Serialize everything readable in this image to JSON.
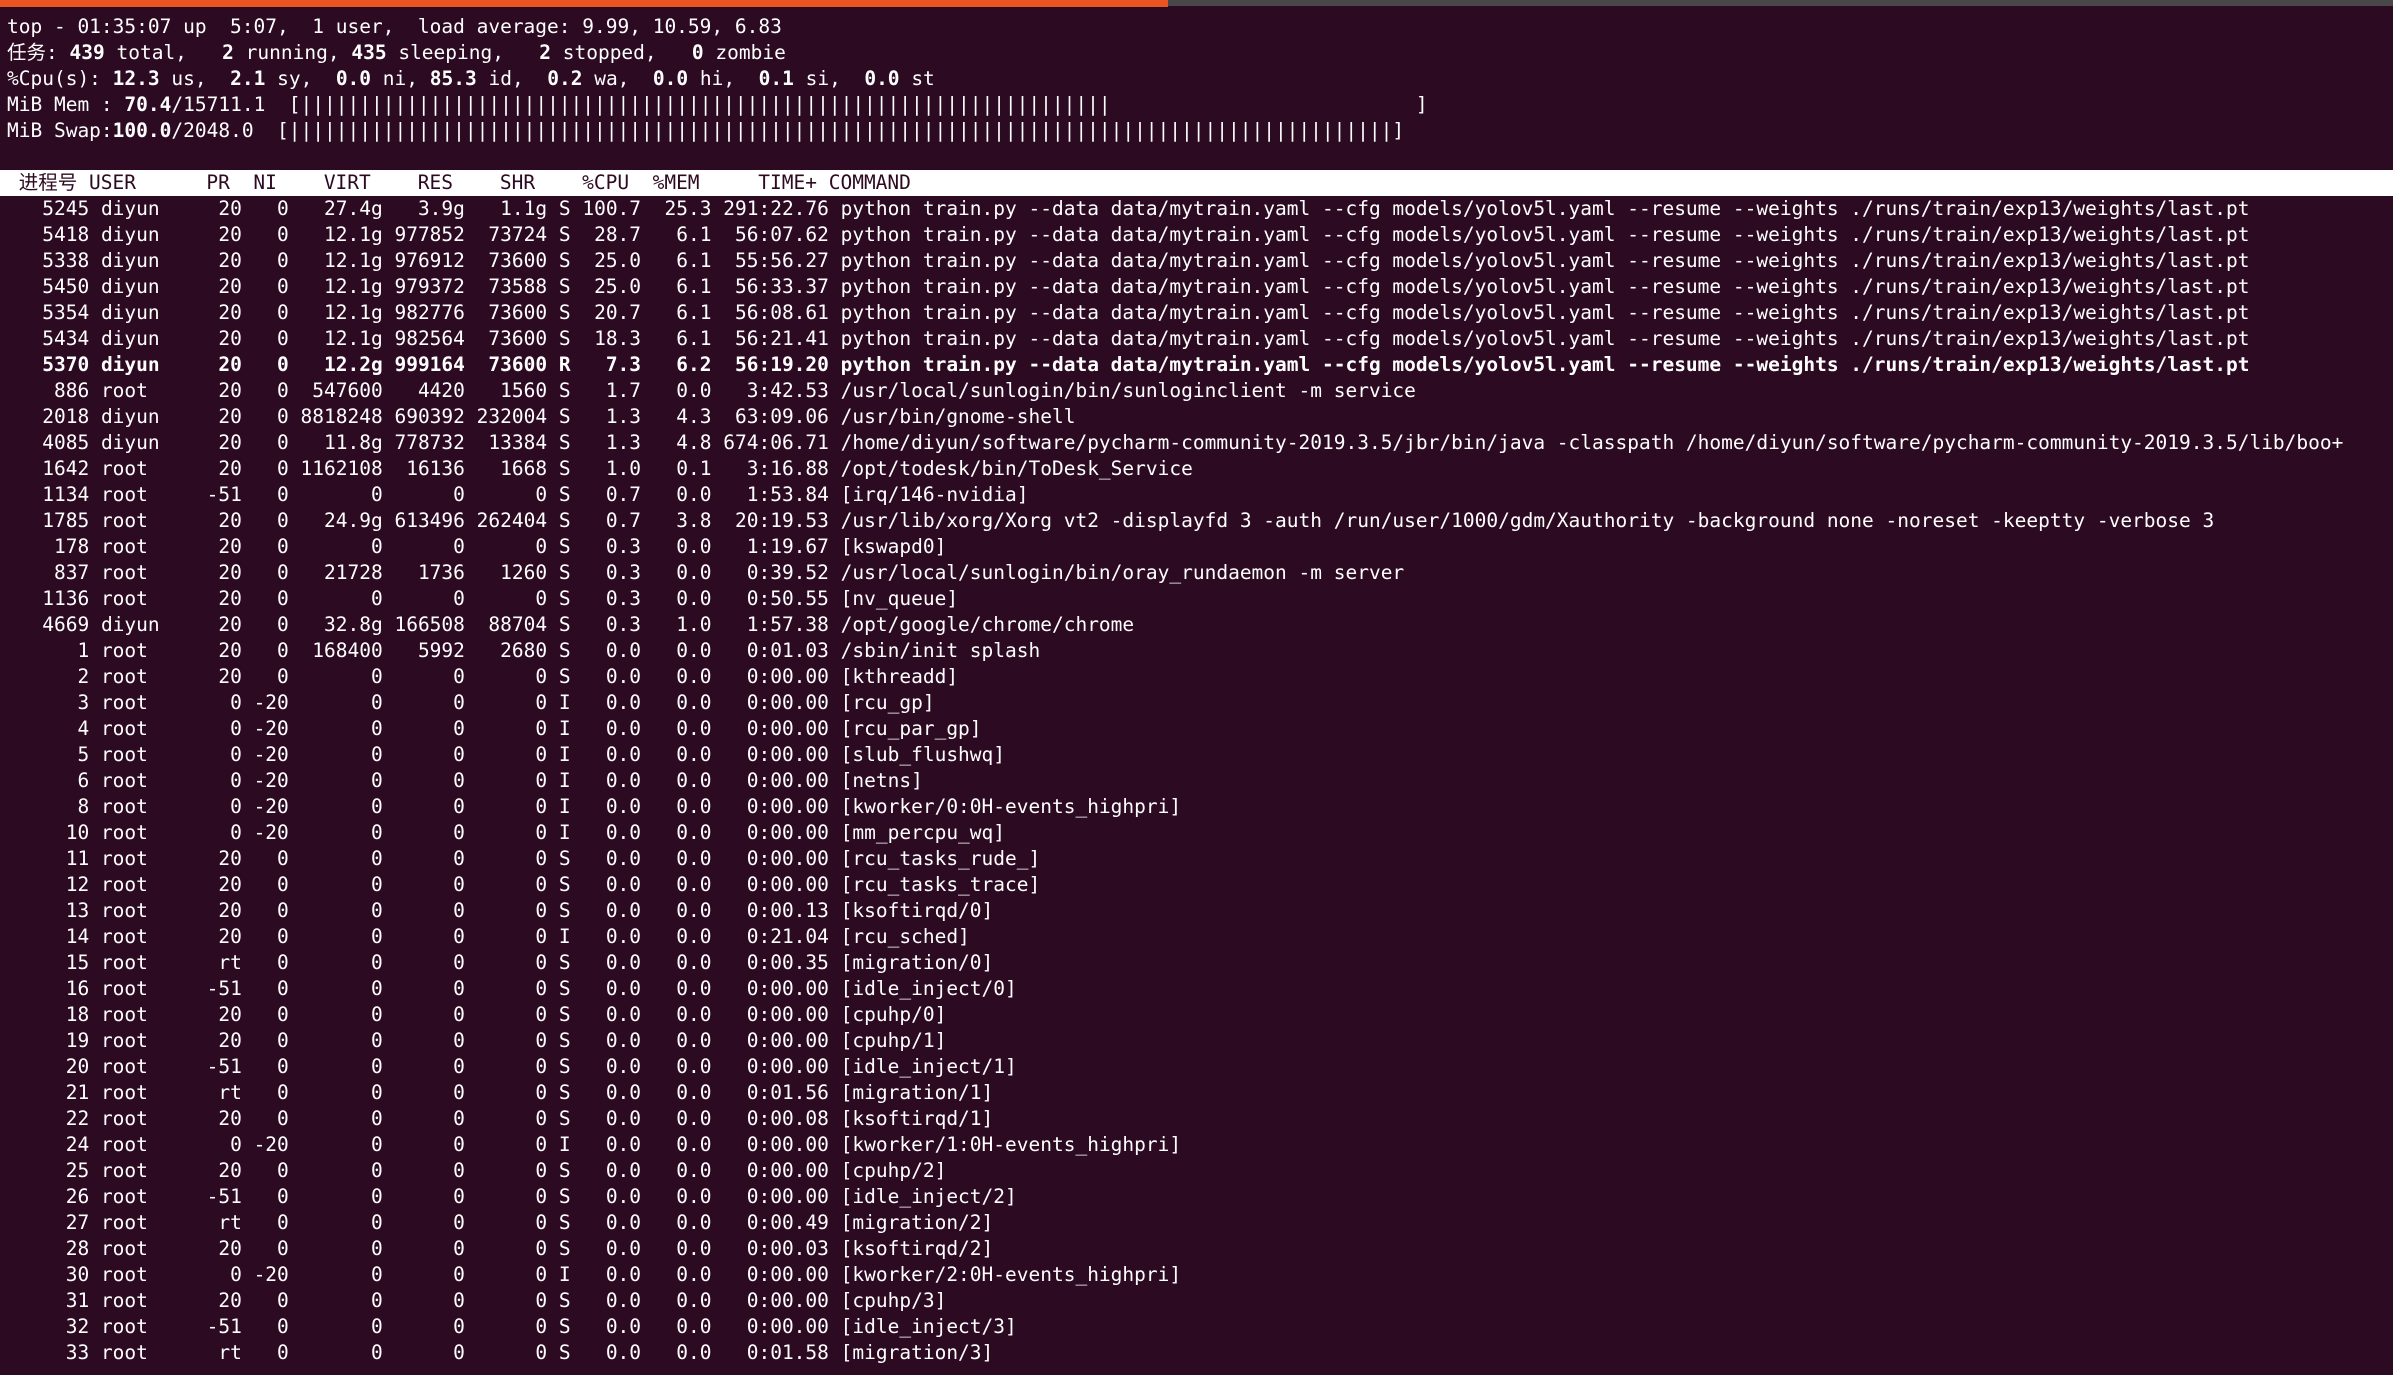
{
  "colors": {
    "background": "#2c0a22",
    "foreground": "#ffffff",
    "accent": "#e95420",
    "header_bar": "#ffffff"
  },
  "summary": {
    "uptime_line": "top - 01:35:07 up  5:07,  1 user,  load average: 9.99, 10.59, 6.83",
    "tasks": {
      "label": "任务:",
      "total": "439",
      "total_label": "total,",
      "running": "2",
      "running_label": "running,",
      "sleeping": "435",
      "sleeping_label": "sleeping,",
      "stopped": "2",
      "stopped_label": "stopped,",
      "zombie": "0",
      "zombie_label": "zombie"
    },
    "cpu": {
      "label": "%Cpu(s):",
      "us": "12.3",
      "us_label": "us,",
      "sy": "2.1",
      "sy_label": "sy,",
      "ni": "0.0",
      "ni_label": "ni,",
      "id": "85.3",
      "id_label": "id,",
      "wa": "0.2",
      "wa_label": "wa,",
      "hi": "0.0",
      "hi_label": "hi,",
      "si": "0.1",
      "si_label": "si,",
      "st": "0.0",
      "st_label": "st"
    },
    "mem": {
      "label": "MiB Mem :",
      "value": "70.4",
      "total": "/15711.1",
      "bar": "[|||||||||||||||||||||||||||||||||||||||||||||||||||||||||||||||||||||                          ]"
    },
    "swap": {
      "label": "MiB Swap:",
      "value": "100.0",
      "total": "/2048.0",
      "bar": "[||||||||||||||||||||||||||||||||||||||||||||||||||||||||||||||||||||||||||||||||||||||||||||||]"
    }
  },
  "columns": {
    "pid": "进程号",
    "user": "USER",
    "pr": "PR",
    "ni": "NI",
    "virt": "VIRT",
    "res": "RES",
    "shr": "SHR",
    "s": "",
    "cpu": "%CPU",
    "mem": "%MEM",
    "time": "TIME+",
    "command": "COMMAND"
  },
  "processes": [
    {
      "pid": "5245",
      "user": "diyun",
      "pr": "20",
      "ni": "0",
      "virt": "27.4g",
      "res": "3.9g",
      "shr": "1.1g",
      "s": "S",
      "cpu": "100.7",
      "mem": "25.3",
      "time": "291:22.76",
      "command": "python train.py --data data/mytrain.yaml --cfg models/yolov5l.yaml --resume --weights ./runs/train/exp13/weights/last.pt"
    },
    {
      "pid": "5418",
      "user": "diyun",
      "pr": "20",
      "ni": "0",
      "virt": "12.1g",
      "res": "977852",
      "shr": "73724",
      "s": "S",
      "cpu": "28.7",
      "mem": "6.1",
      "time": "56:07.62",
      "command": "python train.py --data data/mytrain.yaml --cfg models/yolov5l.yaml --resume --weights ./runs/train/exp13/weights/last.pt"
    },
    {
      "pid": "5338",
      "user": "diyun",
      "pr": "20",
      "ni": "0",
      "virt": "12.1g",
      "res": "976912",
      "shr": "73600",
      "s": "S",
      "cpu": "25.0",
      "mem": "6.1",
      "time": "55:56.27",
      "command": "python train.py --data data/mytrain.yaml --cfg models/yolov5l.yaml --resume --weights ./runs/train/exp13/weights/last.pt"
    },
    {
      "pid": "5450",
      "user": "diyun",
      "pr": "20",
      "ni": "0",
      "virt": "12.1g",
      "res": "979372",
      "shr": "73588",
      "s": "S",
      "cpu": "25.0",
      "mem": "6.1",
      "time": "56:33.37",
      "command": "python train.py --data data/mytrain.yaml --cfg models/yolov5l.yaml --resume --weights ./runs/train/exp13/weights/last.pt"
    },
    {
      "pid": "5354",
      "user": "diyun",
      "pr": "20",
      "ni": "0",
      "virt": "12.1g",
      "res": "982776",
      "shr": "73600",
      "s": "S",
      "cpu": "20.7",
      "mem": "6.1",
      "time": "56:08.61",
      "command": "python train.py --data data/mytrain.yaml --cfg models/yolov5l.yaml --resume --weights ./runs/train/exp13/weights/last.pt"
    },
    {
      "pid": "5434",
      "user": "diyun",
      "pr": "20",
      "ni": "0",
      "virt": "12.1g",
      "res": "982564",
      "shr": "73600",
      "s": "S",
      "cpu": "18.3",
      "mem": "6.1",
      "time": "56:21.41",
      "command": "python train.py --data data/mytrain.yaml --cfg models/yolov5l.yaml --resume --weights ./runs/train/exp13/weights/last.pt"
    },
    {
      "pid": "5370",
      "user": "diyun",
      "pr": "20",
      "ni": "0",
      "virt": "12.2g",
      "res": "999164",
      "shr": "73600",
      "s": "R",
      "cpu": "7.3",
      "mem": "6.2",
      "time": "56:19.20",
      "command": "python train.py --data data/mytrain.yaml --cfg models/yolov5l.yaml --resume --weights ./runs/train/exp13/weights/last.pt",
      "bold": true
    },
    {
      "pid": "886",
      "user": "root",
      "pr": "20",
      "ni": "0",
      "virt": "547600",
      "res": "4420",
      "shr": "1560",
      "s": "S",
      "cpu": "1.7",
      "mem": "0.0",
      "time": "3:42.53",
      "command": "/usr/local/sunlogin/bin/sunloginclient -m service"
    },
    {
      "pid": "2018",
      "user": "diyun",
      "pr": "20",
      "ni": "0",
      "virt": "8818248",
      "res": "690392",
      "shr": "232004",
      "s": "S",
      "cpu": "1.3",
      "mem": "4.3",
      "time": "63:09.06",
      "command": "/usr/bin/gnome-shell"
    },
    {
      "pid": "4085",
      "user": "diyun",
      "pr": "20",
      "ni": "0",
      "virt": "11.8g",
      "res": "778732",
      "shr": "13384",
      "s": "S",
      "cpu": "1.3",
      "mem": "4.8",
      "time": "674:06.71",
      "command": "/home/diyun/software/pycharm-community-2019.3.5/jbr/bin/java -classpath /home/diyun/software/pycharm-community-2019.3.5/lib/boo+"
    },
    {
      "pid": "1642",
      "user": "root",
      "pr": "20",
      "ni": "0",
      "virt": "1162108",
      "res": "16136",
      "shr": "1668",
      "s": "S",
      "cpu": "1.0",
      "mem": "0.1",
      "time": "3:16.88",
      "command": "/opt/todesk/bin/ToDesk_Service"
    },
    {
      "pid": "1134",
      "user": "root",
      "pr": "-51",
      "ni": "0",
      "virt": "0",
      "res": "0",
      "shr": "0",
      "s": "S",
      "cpu": "0.7",
      "mem": "0.0",
      "time": "1:53.84",
      "command": "[irq/146-nvidia]"
    },
    {
      "pid": "1785",
      "user": "root",
      "pr": "20",
      "ni": "0",
      "virt": "24.9g",
      "res": "613496",
      "shr": "262404",
      "s": "S",
      "cpu": "0.7",
      "mem": "3.8",
      "time": "20:19.53",
      "command": "/usr/lib/xorg/Xorg vt2 -displayfd 3 -auth /run/user/1000/gdm/Xauthority -background none -noreset -keeptty -verbose 3"
    },
    {
      "pid": "178",
      "user": "root",
      "pr": "20",
      "ni": "0",
      "virt": "0",
      "res": "0",
      "shr": "0",
      "s": "S",
      "cpu": "0.3",
      "mem": "0.0",
      "time": "1:19.67",
      "command": "[kswapd0]"
    },
    {
      "pid": "837",
      "user": "root",
      "pr": "20",
      "ni": "0",
      "virt": "21728",
      "res": "1736",
      "shr": "1260",
      "s": "S",
      "cpu": "0.3",
      "mem": "0.0",
      "time": "0:39.52",
      "command": "/usr/local/sunlogin/bin/oray_rundaemon -m server"
    },
    {
      "pid": "1136",
      "user": "root",
      "pr": "20",
      "ni": "0",
      "virt": "0",
      "res": "0",
      "shr": "0",
      "s": "S",
      "cpu": "0.3",
      "mem": "0.0",
      "time": "0:50.55",
      "command": "[nv_queue]"
    },
    {
      "pid": "4669",
      "user": "diyun",
      "pr": "20",
      "ni": "0",
      "virt": "32.8g",
      "res": "166508",
      "shr": "88704",
      "s": "S",
      "cpu": "0.3",
      "mem": "1.0",
      "time": "1:57.38",
      "command": "/opt/google/chrome/chrome"
    },
    {
      "pid": "1",
      "user": "root",
      "pr": "20",
      "ni": "0",
      "virt": "168400",
      "res": "5992",
      "shr": "2680",
      "s": "S",
      "cpu": "0.0",
      "mem": "0.0",
      "time": "0:01.03",
      "command": "/sbin/init splash"
    },
    {
      "pid": "2",
      "user": "root",
      "pr": "20",
      "ni": "0",
      "virt": "0",
      "res": "0",
      "shr": "0",
      "s": "S",
      "cpu": "0.0",
      "mem": "0.0",
      "time": "0:00.00",
      "command": "[kthreadd]"
    },
    {
      "pid": "3",
      "user": "root",
      "pr": "0",
      "ni": "-20",
      "virt": "0",
      "res": "0",
      "shr": "0",
      "s": "I",
      "cpu": "0.0",
      "mem": "0.0",
      "time": "0:00.00",
      "command": "[rcu_gp]"
    },
    {
      "pid": "4",
      "user": "root",
      "pr": "0",
      "ni": "-20",
      "virt": "0",
      "res": "0",
      "shr": "0",
      "s": "I",
      "cpu": "0.0",
      "mem": "0.0",
      "time": "0:00.00",
      "command": "[rcu_par_gp]"
    },
    {
      "pid": "5",
      "user": "root",
      "pr": "0",
      "ni": "-20",
      "virt": "0",
      "res": "0",
      "shr": "0",
      "s": "I",
      "cpu": "0.0",
      "mem": "0.0",
      "time": "0:00.00",
      "command": "[slub_flushwq]"
    },
    {
      "pid": "6",
      "user": "root",
      "pr": "0",
      "ni": "-20",
      "virt": "0",
      "res": "0",
      "shr": "0",
      "s": "I",
      "cpu": "0.0",
      "mem": "0.0",
      "time": "0:00.00",
      "command": "[netns]"
    },
    {
      "pid": "8",
      "user": "root",
      "pr": "0",
      "ni": "-20",
      "virt": "0",
      "res": "0",
      "shr": "0",
      "s": "I",
      "cpu": "0.0",
      "mem": "0.0",
      "time": "0:00.00",
      "command": "[kworker/0:0H-events_highpri]"
    },
    {
      "pid": "10",
      "user": "root",
      "pr": "0",
      "ni": "-20",
      "virt": "0",
      "res": "0",
      "shr": "0",
      "s": "I",
      "cpu": "0.0",
      "mem": "0.0",
      "time": "0:00.00",
      "command": "[mm_percpu_wq]"
    },
    {
      "pid": "11",
      "user": "root",
      "pr": "20",
      "ni": "0",
      "virt": "0",
      "res": "0",
      "shr": "0",
      "s": "S",
      "cpu": "0.0",
      "mem": "0.0",
      "time": "0:00.00",
      "command": "[rcu_tasks_rude_]"
    },
    {
      "pid": "12",
      "user": "root",
      "pr": "20",
      "ni": "0",
      "virt": "0",
      "res": "0",
      "shr": "0",
      "s": "S",
      "cpu": "0.0",
      "mem": "0.0",
      "time": "0:00.00",
      "command": "[rcu_tasks_trace]"
    },
    {
      "pid": "13",
      "user": "root",
      "pr": "20",
      "ni": "0",
      "virt": "0",
      "res": "0",
      "shr": "0",
      "s": "S",
      "cpu": "0.0",
      "mem": "0.0",
      "time": "0:00.13",
      "command": "[ksoftirqd/0]"
    },
    {
      "pid": "14",
      "user": "root",
      "pr": "20",
      "ni": "0",
      "virt": "0",
      "res": "0",
      "shr": "0",
      "s": "I",
      "cpu": "0.0",
      "mem": "0.0",
      "time": "0:21.04",
      "command": "[rcu_sched]"
    },
    {
      "pid": "15",
      "user": "root",
      "pr": "rt",
      "ni": "0",
      "virt": "0",
      "res": "0",
      "shr": "0",
      "s": "S",
      "cpu": "0.0",
      "mem": "0.0",
      "time": "0:00.35",
      "command": "[migration/0]"
    },
    {
      "pid": "16",
      "user": "root",
      "pr": "-51",
      "ni": "0",
      "virt": "0",
      "res": "0",
      "shr": "0",
      "s": "S",
      "cpu": "0.0",
      "mem": "0.0",
      "time": "0:00.00",
      "command": "[idle_inject/0]"
    },
    {
      "pid": "18",
      "user": "root",
      "pr": "20",
      "ni": "0",
      "virt": "0",
      "res": "0",
      "shr": "0",
      "s": "S",
      "cpu": "0.0",
      "mem": "0.0",
      "time": "0:00.00",
      "command": "[cpuhp/0]"
    },
    {
      "pid": "19",
      "user": "root",
      "pr": "20",
      "ni": "0",
      "virt": "0",
      "res": "0",
      "shr": "0",
      "s": "S",
      "cpu": "0.0",
      "mem": "0.0",
      "time": "0:00.00",
      "command": "[cpuhp/1]"
    },
    {
      "pid": "20",
      "user": "root",
      "pr": "-51",
      "ni": "0",
      "virt": "0",
      "res": "0",
      "shr": "0",
      "s": "S",
      "cpu": "0.0",
      "mem": "0.0",
      "time": "0:00.00",
      "command": "[idle_inject/1]"
    },
    {
      "pid": "21",
      "user": "root",
      "pr": "rt",
      "ni": "0",
      "virt": "0",
      "res": "0",
      "shr": "0",
      "s": "S",
      "cpu": "0.0",
      "mem": "0.0",
      "time": "0:01.56",
      "command": "[migration/1]"
    },
    {
      "pid": "22",
      "user": "root",
      "pr": "20",
      "ni": "0",
      "virt": "0",
      "res": "0",
      "shr": "0",
      "s": "S",
      "cpu": "0.0",
      "mem": "0.0",
      "time": "0:00.08",
      "command": "[ksoftirqd/1]"
    },
    {
      "pid": "24",
      "user": "root",
      "pr": "0",
      "ni": "-20",
      "virt": "0",
      "res": "0",
      "shr": "0",
      "s": "I",
      "cpu": "0.0",
      "mem": "0.0",
      "time": "0:00.00",
      "command": "[kworker/1:0H-events_highpri]"
    },
    {
      "pid": "25",
      "user": "root",
      "pr": "20",
      "ni": "0",
      "virt": "0",
      "res": "0",
      "shr": "0",
      "s": "S",
      "cpu": "0.0",
      "mem": "0.0",
      "time": "0:00.00",
      "command": "[cpuhp/2]"
    },
    {
      "pid": "26",
      "user": "root",
      "pr": "-51",
      "ni": "0",
      "virt": "0",
      "res": "0",
      "shr": "0",
      "s": "S",
      "cpu": "0.0",
      "mem": "0.0",
      "time": "0:00.00",
      "command": "[idle_inject/2]"
    },
    {
      "pid": "27",
      "user": "root",
      "pr": "rt",
      "ni": "0",
      "virt": "0",
      "res": "0",
      "shr": "0",
      "s": "S",
      "cpu": "0.0",
      "mem": "0.0",
      "time": "0:00.49",
      "command": "[migration/2]"
    },
    {
      "pid": "28",
      "user": "root",
      "pr": "20",
      "ni": "0",
      "virt": "0",
      "res": "0",
      "shr": "0",
      "s": "S",
      "cpu": "0.0",
      "mem": "0.0",
      "time": "0:00.03",
      "command": "[ksoftirqd/2]"
    },
    {
      "pid": "30",
      "user": "root",
      "pr": "0",
      "ni": "-20",
      "virt": "0",
      "res": "0",
      "shr": "0",
      "s": "I",
      "cpu": "0.0",
      "mem": "0.0",
      "time": "0:00.00",
      "command": "[kworker/2:0H-events_highpri]"
    },
    {
      "pid": "31",
      "user": "root",
      "pr": "20",
      "ni": "0",
      "virt": "0",
      "res": "0",
      "shr": "0",
      "s": "S",
      "cpu": "0.0",
      "mem": "0.0",
      "time": "0:00.00",
      "command": "[cpuhp/3]"
    },
    {
      "pid": "32",
      "user": "root",
      "pr": "-51",
      "ni": "0",
      "virt": "0",
      "res": "0",
      "shr": "0",
      "s": "S",
      "cpu": "0.0",
      "mem": "0.0",
      "time": "0:00.00",
      "command": "[idle_inject/3]"
    },
    {
      "pid": "33",
      "user": "root",
      "pr": "rt",
      "ni": "0",
      "virt": "0",
      "res": "0",
      "shr": "0",
      "s": "S",
      "cpu": "0.0",
      "mem": "0.0",
      "time": "0:01.58",
      "command": "[migration/3]"
    }
  ]
}
